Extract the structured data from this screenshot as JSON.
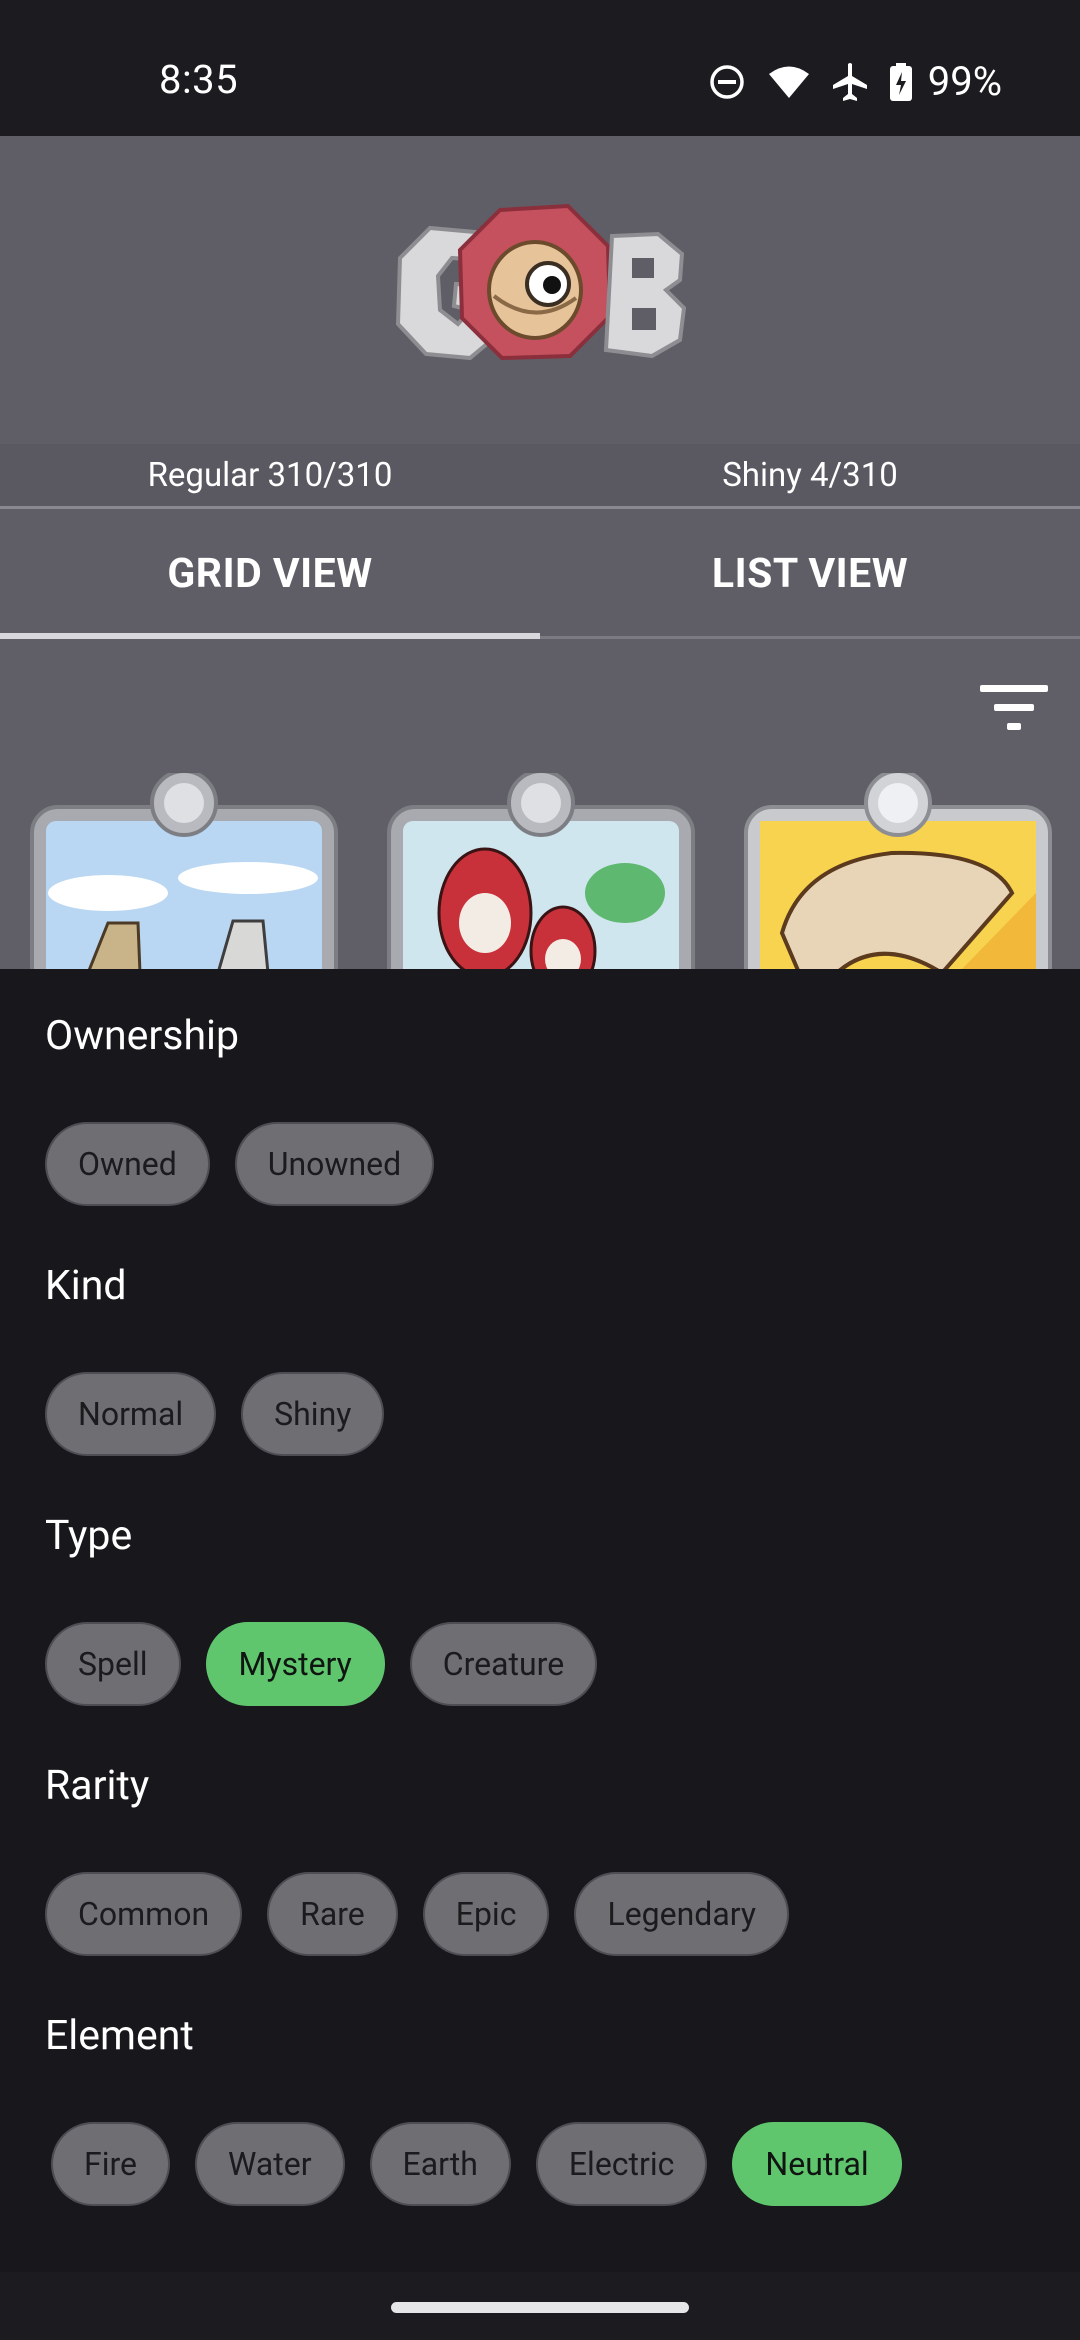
{
  "status_bar": {
    "time": "8:35",
    "battery": "99%",
    "icons": [
      "do-not-disturb-icon",
      "wifi-icon",
      "airplane-mode-icon",
      "battery-charging-icon"
    ]
  },
  "header": {
    "logo_text": "GOB",
    "regular_count": "Regular 310/310",
    "shiny_count": "Shiny 4/310"
  },
  "tabs": [
    {
      "label": "GRID VIEW",
      "selected": true
    },
    {
      "label": "LIST VIEW",
      "selected": false
    }
  ],
  "filters": {
    "ownership": {
      "title": "Ownership",
      "options": [
        "Owned",
        "Unowned"
      ]
    },
    "kind": {
      "title": "Kind",
      "options": [
        "Normal",
        "Shiny"
      ]
    },
    "type": {
      "title": "Type",
      "options": [
        "Spell",
        "Mystery",
        "Creature"
      ],
      "selected": "Mystery"
    },
    "rarity": {
      "title": "Rarity",
      "options": [
        "Common",
        "Rare",
        "Epic",
        "Legendary"
      ]
    },
    "element": {
      "title": "Element",
      "options": [
        "Fire",
        "Water",
        "Earth",
        "Electric",
        "Neutral"
      ],
      "selected": "Neutral"
    }
  },
  "colors": {
    "chip_default": "#6e6e73",
    "chip_selected": "#5fc66e",
    "sheet_background": "#18171c",
    "header_background": "#5f5e67"
  }
}
